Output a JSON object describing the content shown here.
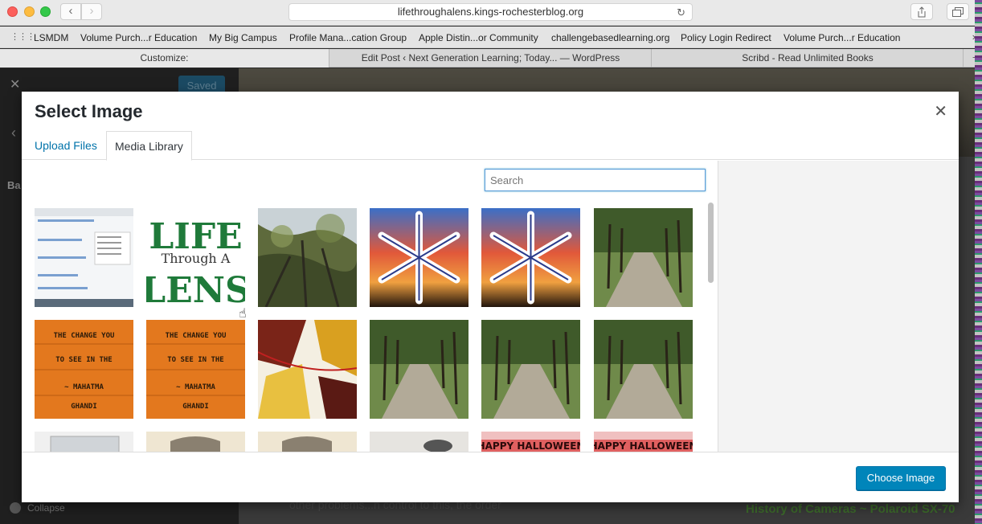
{
  "browser": {
    "url": "lifethroughalens.kings-rochesterblog.org",
    "back_icon": "chevron-left",
    "forward_icon": "chevron-right",
    "reload_icon": "reload",
    "bookmarks": [
      "LSMDM",
      "Volume Purch...r Education",
      "My Big Campus",
      "Profile Mana...cation Group",
      "Apple Distin...or Community",
      "challengebasedlearning.org",
      "Policy Login Redirect",
      "Volume Purch...r Education"
    ],
    "tabs": [
      "Customize:",
      "Edit Post ‹ Next Generation Learning; Today... — WordPress",
      "Scribd - Read Unlimited Books"
    ]
  },
  "background_page": {
    "saved_label": "Saved",
    "section_label": "Ba",
    "collapse_label": "Collapse",
    "preview_text": "other problems...n control to this, the order",
    "preview_link": "History of Cameras ~ Polaroid SX-70"
  },
  "modal": {
    "title": "Select Image",
    "tabs": {
      "upload": "Upload Files",
      "library": "Media Library"
    },
    "search_placeholder": "Search",
    "choose_button": "Choose Image",
    "thumbnails": [
      "screenshot",
      "life-through-a-lens-logo",
      "tree-canopy",
      "snowflake-sunset",
      "snowflake-sunset",
      "tree-lined-path",
      "change-you-wish-orange",
      "change-you-wish-orange",
      "autumn-leaves",
      "tree-lined-path",
      "tree-lined-path",
      "tree-lined-path",
      "camera-white",
      "camera-vintage",
      "camera-vintage",
      "camera-sepia",
      "happy-halloween-red",
      "happy-halloween-red"
    ],
    "logo_text": {
      "line1": "LIFE",
      "line2": "Through A",
      "line3": "LENS"
    },
    "orange_text": {
      "line1": "THE CHANGE YOU",
      "line2": "TO SEE IN THE",
      "line3": "~ MAHATMA",
      "line4": "GHANDI"
    },
    "halloween_text": "HAPPY HALLOWEEN"
  },
  "colors": {
    "accent": "#0085ba",
    "link": "#0073aa",
    "title": "#23282d"
  }
}
